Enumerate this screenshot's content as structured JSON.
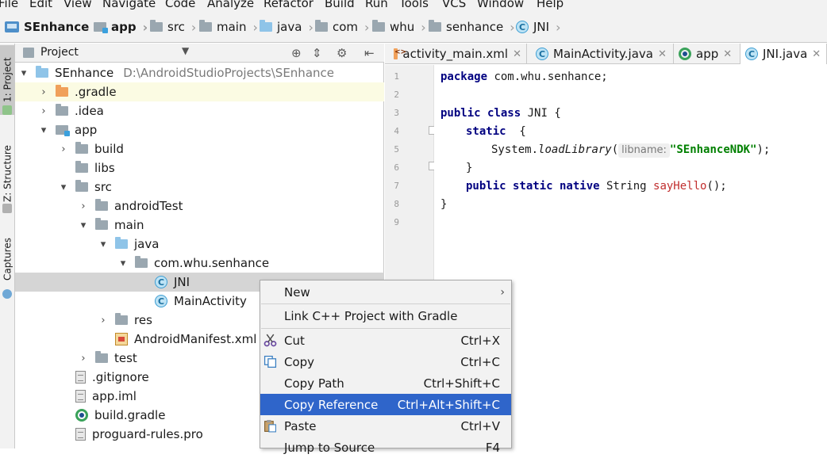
{
  "menubar": [
    "File",
    "Edit",
    "View",
    "Navigate",
    "Code",
    "Analyze",
    "Refactor",
    "Build",
    "Run",
    "Tools",
    "VCS",
    "Window",
    "Help"
  ],
  "breadcrumb": [
    "SEnhance",
    "app",
    "src",
    "main",
    "java",
    "com",
    "whu",
    "senhance",
    "JNI"
  ],
  "left_strip": {
    "project_tab": "1: Project",
    "structure_tab": "Z: Structure",
    "captures_tab": "Captures"
  },
  "project_panel": {
    "title": "Project",
    "tree": [
      {
        "label": "SEnhance",
        "path": "D:\\AndroidStudioProjects\\SEnhance",
        "arrow": "▾",
        "icon": "project-icon"
      },
      {
        "label": ".gradle",
        "arrow": "›",
        "icon": "folder-orange-icon"
      },
      {
        "label": ".idea",
        "arrow": "›",
        "icon": "folder-icon"
      },
      {
        "label": "app",
        "arrow": "▾",
        "icon": "module-icon"
      },
      {
        "label": "build",
        "arrow": "›",
        "icon": "folder-icon"
      },
      {
        "label": "libs",
        "arrow": "",
        "icon": "folder-icon"
      },
      {
        "label": "src",
        "arrow": "▾",
        "icon": "folder-icon"
      },
      {
        "label": "androidTest",
        "arrow": "›",
        "icon": "folder-icon"
      },
      {
        "label": "main",
        "arrow": "▾",
        "icon": "folder-icon"
      },
      {
        "label": "java",
        "arrow": "▾",
        "icon": "folder-blue-icon"
      },
      {
        "label": "com.whu.senhance",
        "arrow": "▾",
        "icon": "package-icon"
      },
      {
        "label": "JNI",
        "arrow": "",
        "icon": "class-icon"
      },
      {
        "label": "MainActivity",
        "arrow": "",
        "icon": "class-icon"
      },
      {
        "label": "res",
        "arrow": "›",
        "icon": "res-folder-icon"
      },
      {
        "label": "AndroidManifest.xml",
        "arrow": "",
        "icon": "manifest-icon"
      },
      {
        "label": "test",
        "arrow": "›",
        "icon": "folder-icon"
      },
      {
        "label": ".gitignore",
        "arrow": "",
        "icon": "file-icon"
      },
      {
        "label": "app.iml",
        "arrow": "",
        "icon": "file-icon"
      },
      {
        "label": "build.gradle",
        "arrow": "",
        "icon": "gradle-icon"
      },
      {
        "label": "proguard-rules.pro",
        "arrow": "",
        "icon": "file-icon"
      }
    ]
  },
  "editor": {
    "tabs": [
      "activity_main.xml",
      "MainActivity.java",
      "app",
      "JNI.java"
    ],
    "line_numbers": [
      "1",
      "2",
      "3",
      "4",
      "5",
      "6",
      "7",
      "8",
      "9"
    ],
    "code": {
      "l1_kw": "package",
      "l1_rest": " com.whu.senhance;",
      "l3_kw1": "public",
      "l3_kw2": "class",
      "l3_rest": " JNI {",
      "l4_kw": "static",
      "l4_rest": "  {",
      "l5_pre": "System.",
      "l5_method": "loadLibrary",
      "l5_paren": "(",
      "l5_hint": "libname:",
      "l5_str": "\"SEnhanceNDK\"",
      "l5_end": ");",
      "l6": "}",
      "l7_kw": "public static native",
      "l7_type": " String ",
      "l7_method": "sayHello",
      "l7_end": "();",
      "l8": "}"
    }
  },
  "context_menu": {
    "items": [
      {
        "label": "New",
        "shortcut": "",
        "submenu": true
      },
      {
        "label": "Link C++ Project with Gradle",
        "shortcut": ""
      },
      {
        "label": "Cut",
        "shortcut": "Ctrl+X"
      },
      {
        "label": "Copy",
        "shortcut": "Ctrl+C"
      },
      {
        "label": "Copy Path",
        "shortcut": "Ctrl+Shift+C"
      },
      {
        "label": "Copy Reference",
        "shortcut": "Ctrl+Alt+Shift+C"
      },
      {
        "label": "Paste",
        "shortcut": "Ctrl+V"
      },
      {
        "label": "Jump to Source",
        "shortcut": "F4"
      }
    ]
  },
  "colors": {
    "selection": "#2f65ca",
    "keyword": "#000080",
    "string": "#008000",
    "declaration": "#c12e2e",
    "caret_line": "#fbfbe3"
  }
}
